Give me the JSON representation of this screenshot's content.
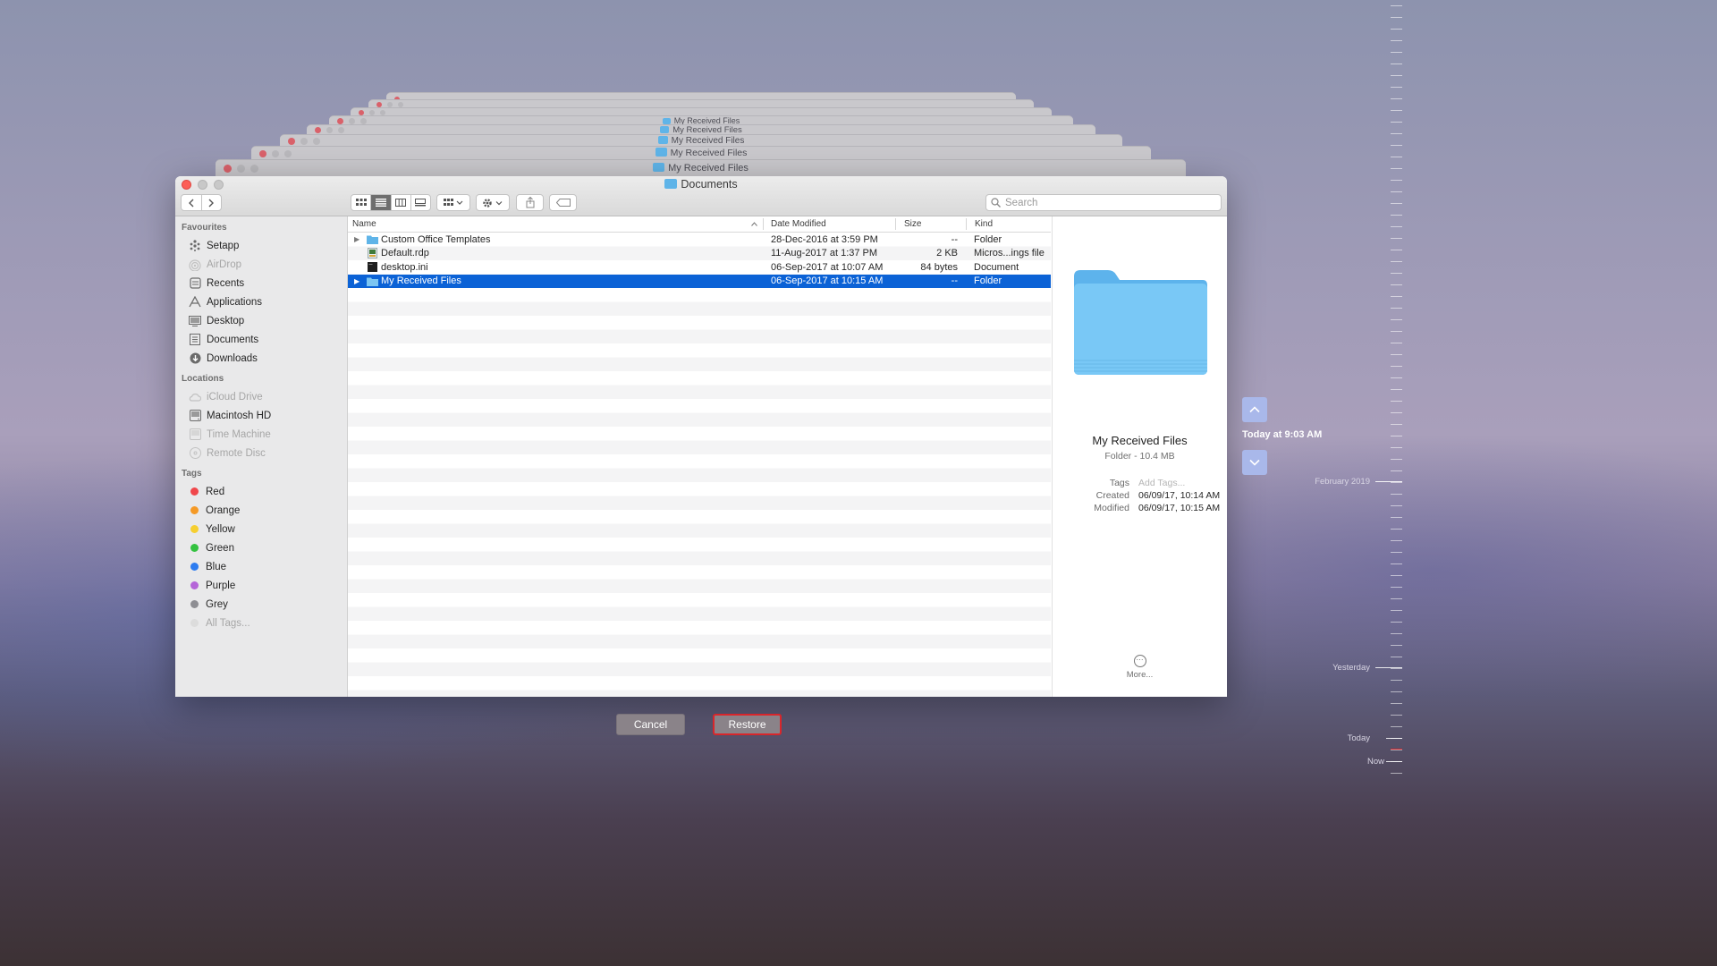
{
  "stack": {
    "title": "My Received Files"
  },
  "window": {
    "title": "Documents"
  },
  "toolbar": {
    "search_placeholder": "Search"
  },
  "sidebar": {
    "favourites_header": "Favourites",
    "favourites": [
      {
        "label": "Setapp",
        "icon": "setapp-icon",
        "dim": false
      },
      {
        "label": "AirDrop",
        "icon": "airdrop-icon",
        "dim": true
      },
      {
        "label": "Recents",
        "icon": "recents-icon",
        "dim": false
      },
      {
        "label": "Applications",
        "icon": "applications-icon",
        "dim": false
      },
      {
        "label": "Desktop",
        "icon": "desktop-icon",
        "dim": false
      },
      {
        "label": "Documents",
        "icon": "documents-icon",
        "dim": false
      },
      {
        "label": "Downloads",
        "icon": "downloads-icon",
        "dim": false
      }
    ],
    "locations_header": "Locations",
    "locations": [
      {
        "label": "iCloud Drive",
        "icon": "icloud-icon",
        "dim": true
      },
      {
        "label": "Macintosh HD",
        "icon": "harddisk-icon",
        "dim": false
      },
      {
        "label": "Time Machine",
        "icon": "time-machine-icon",
        "dim": true
      },
      {
        "label": "Remote Disc",
        "icon": "disc-icon",
        "dim": true
      }
    ],
    "tags_header": "Tags",
    "tags": [
      {
        "label": "Red",
        "color": "#f0474b"
      },
      {
        "label": "Orange",
        "color": "#f59a26"
      },
      {
        "label": "Yellow",
        "color": "#f6cf30"
      },
      {
        "label": "Green",
        "color": "#34c240"
      },
      {
        "label": "Blue",
        "color": "#2d7cf0"
      },
      {
        "label": "Purple",
        "color": "#b565d8"
      },
      {
        "label": "Grey",
        "color": "#8e8e93"
      }
    ],
    "all_tags": "All Tags..."
  },
  "columns": {
    "name": "Name",
    "date": "Date Modified",
    "size": "Size",
    "kind": "Kind"
  },
  "files": [
    {
      "name": "Custom Office Templates",
      "date": "28-Dec-2016 at 3:59 PM",
      "size": "--",
      "kind": "Folder",
      "icon": "folder-icon",
      "expandable": true,
      "selected": false
    },
    {
      "name": "Default.rdp",
      "date": "11-Aug-2017 at 1:37 PM",
      "size": "2 KB",
      "kind": "Micros...ings file",
      "icon": "rdp-file-icon",
      "expandable": false,
      "selected": false
    },
    {
      "name": "desktop.ini",
      "date": "06-Sep-2017 at 10:07 AM",
      "size": "84 bytes",
      "kind": "Document",
      "icon": "document-icon",
      "expandable": false,
      "selected": false
    },
    {
      "name": "My Received Files",
      "date": "06-Sep-2017 at 10:15 AM",
      "size": "--",
      "kind": "Folder",
      "icon": "folder-icon",
      "expandable": true,
      "selected": true
    }
  ],
  "preview": {
    "name": "My Received Files",
    "subtitle": "Folder - 10.4 MB",
    "tags_label": "Tags",
    "tags_placeholder": "Add Tags...",
    "created_label": "Created",
    "created_value": "06/09/17, 10:14 AM",
    "modified_label": "Modified",
    "modified_value": "06/09/17, 10:15 AM",
    "more_label": "More..."
  },
  "buttons": {
    "cancel": "Cancel",
    "restore": "Restore"
  },
  "time_machine": {
    "current_snapshot": "Today at 9:03 AM",
    "timeline_labels": {
      "february": "February 2019",
      "yesterday": "Yesterday",
      "today": "Today",
      "now": "Now"
    }
  },
  "colors": {
    "selection": "#0b62d6",
    "folder": "#5fb4e8",
    "restore_border": "#d8262b"
  }
}
